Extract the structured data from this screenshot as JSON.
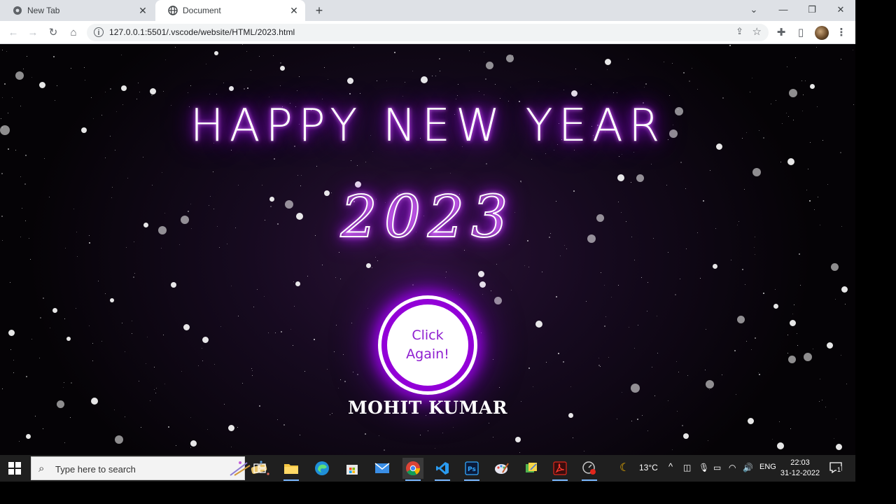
{
  "browser": {
    "tabs": [
      {
        "label": "New Tab",
        "active": false
      },
      {
        "label": "Document",
        "active": true
      }
    ],
    "url": "127.0.0.1:5501/.vscode/website/HTML/2023.html"
  },
  "page": {
    "headline": "HAPPY NEW YEAR",
    "year": "2023",
    "button_line1": "Click",
    "button_line2": "Again!",
    "author": "MOHIT KUMAR",
    "colors": {
      "glow": "#9b00ff",
      "button_text": "#8f1fd0"
    }
  },
  "taskbar": {
    "search_placeholder": "Type here to search",
    "weather": "13°C",
    "language": "ENG",
    "time": "22:03",
    "date": "31-12-2022",
    "notification_count": "1"
  }
}
